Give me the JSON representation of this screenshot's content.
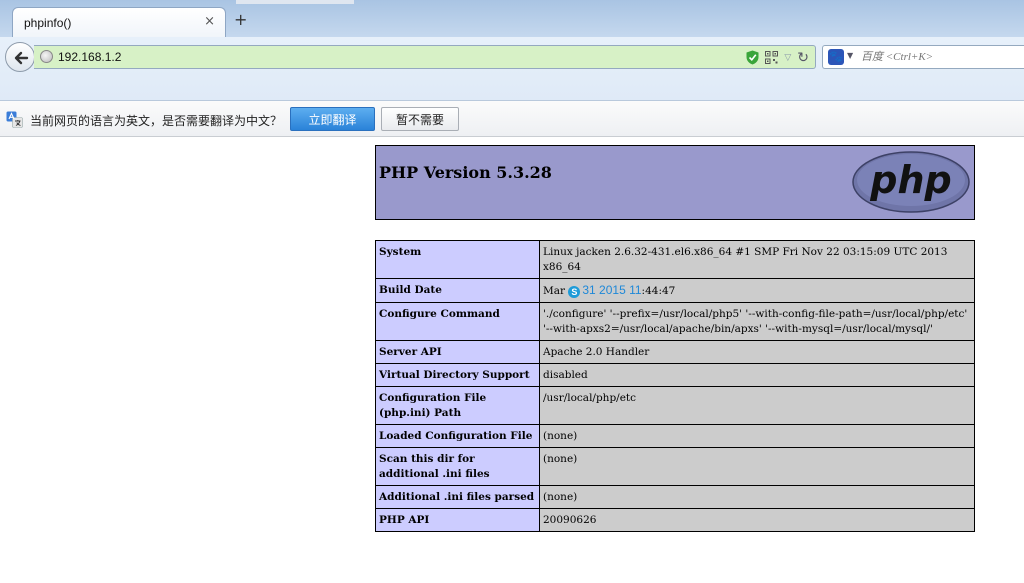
{
  "browser": {
    "tab_title": "phpinfo()",
    "tab_close": "×",
    "new_tab": "+",
    "url": "192.168.1.2",
    "search_placeholder": "百度 <Ctrl+K>",
    "search_engine_glyph": "🐾"
  },
  "translate_bar": {
    "message": "当前网页的语言为英文，是否需要翻译为中文？",
    "translate_button": "立即翻译",
    "dismiss_button": "暂不需要"
  },
  "php": {
    "version_title": "PHP Version 5.3.28",
    "logo_text": "php"
  },
  "info": {
    "rows": [
      {
        "key": "System",
        "value": "Linux jacken 2.6.32-431.el6.x86_64 #1 SMP Fri Nov 22 03:15:09 UTC 2013 x86_64"
      },
      {
        "key": "Build Date",
        "value_prefix": "Mar",
        "value_link": "31 2015 11",
        "value_suffix": ":44:47"
      },
      {
        "key": "Configure Command",
        "value": "'./configure' '--prefix=/usr/local/php5' '--with-config-file-path=/usr/local/php/etc' '--with-apxs2=/usr/local/apache/bin/apxs' '--with-mysql=/usr/local/mysql/'"
      },
      {
        "key": "Server API",
        "value": "Apache 2.0 Handler"
      },
      {
        "key": "Virtual Directory Support",
        "value": "disabled"
      },
      {
        "key": "Configuration File (php.ini) Path",
        "value": "/usr/local/php/etc"
      },
      {
        "key": "Loaded Configuration File",
        "value": "(none)"
      },
      {
        "key": "Scan this dir for additional .ini files",
        "value": "(none)"
      },
      {
        "key": "Additional .ini files parsed",
        "value": "(none)"
      },
      {
        "key": "PHP API",
        "value": "20090626"
      }
    ]
  },
  "colors": {
    "header_bg": "#9999cc",
    "key_bg": "#ccccff",
    "value_bg": "#cccccc",
    "url_bg": "#d7f1c6",
    "translate_button_bg": "#2a82d8"
  }
}
